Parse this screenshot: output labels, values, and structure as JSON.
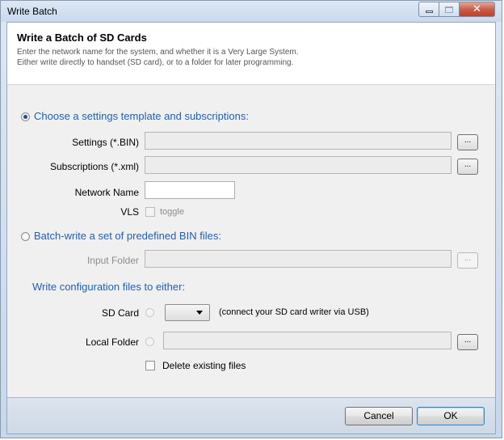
{
  "window": {
    "title": "Write Batch"
  },
  "header": {
    "title": "Write a Batch of SD Cards",
    "line1": "Enter the network name for the system, and whether it is a Very Large System.",
    "line2": "Either write directly to handset (SD card), or to a folder for later programming."
  },
  "template_section": {
    "radio_label": "Choose a settings template and subscriptions:",
    "settings_label": "Settings (*.BIN)",
    "settings_value": "",
    "subscriptions_label": "Subscriptions (*.xml)",
    "subscriptions_value": "",
    "network_name_label": "Network Name",
    "network_name_value": "",
    "vls_label": "VLS",
    "vls_toggle_label": "toggle",
    "browse_label": "..."
  },
  "batch_section": {
    "radio_label": "Batch-write a set of predefined BIN files:",
    "input_folder_label": "Input Folder",
    "input_folder_value": "",
    "browse_label": "..."
  },
  "output_section": {
    "heading": "Write configuration files to either:",
    "sd_card_label": "SD Card",
    "sd_card_selected": "",
    "sd_card_hint": "(connect your SD card writer via USB)",
    "local_folder_label": "Local Folder",
    "local_folder_value": "",
    "browse_label": "...",
    "delete_existing_label": "Delete existing files"
  },
  "footer": {
    "cancel_label": "Cancel",
    "ok_label": "OK"
  }
}
